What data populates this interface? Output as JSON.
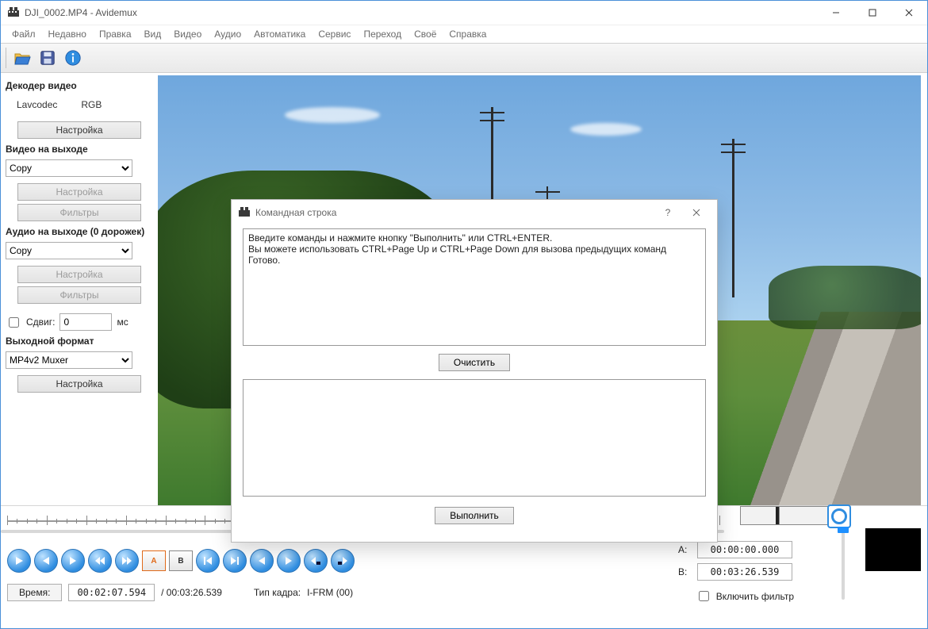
{
  "title": "DJI_0002.MP4 - Avidemux",
  "menu": [
    "Файл",
    "Недавно",
    "Правка",
    "Вид",
    "Видео",
    "Аудио",
    "Автоматика",
    "Сервис",
    "Переход",
    "Своё",
    "Справка"
  ],
  "sidebar": {
    "decoder_heading": "Декодер видео",
    "decoder_codec": "Lavcodec",
    "decoder_color": "RGB",
    "settings_label": "Настройка",
    "filters_label": "Фильтры",
    "video_out_heading": "Видео на выходе",
    "video_out_value": "Copy",
    "audio_out_heading": "Аудио на выходе (0 дорожек)",
    "audio_out_value": "Copy",
    "shift_label": "Сдвиг:",
    "shift_value": "0",
    "shift_unit": "мс",
    "format_heading": "Выходной формат",
    "format_value": "MP4v2 Muxer"
  },
  "dialog": {
    "title": "Командная строка",
    "log": "Введите команды и нажмите кнопку \"Выполнить\" или CTRL+ENTER.\nВы можете использовать CTRL+Page Up и CTRL+Page Down для вызова предыдущих команд\nГотово.",
    "clear_label": "Очистить",
    "run_label": "Выполнить"
  },
  "bottom": {
    "time_label": "Время:",
    "time_value": "00:02:07.594",
    "total_time": "/ 00:03:26.539",
    "frame_type_label": "Тип кадра:",
    "frame_type_value": "I-FRM (00)",
    "a_label": "A:",
    "a_value": "00:00:00.000",
    "b_label": "B:",
    "b_value": "00:03:26.539",
    "filter_label": "Включить фильтр"
  }
}
